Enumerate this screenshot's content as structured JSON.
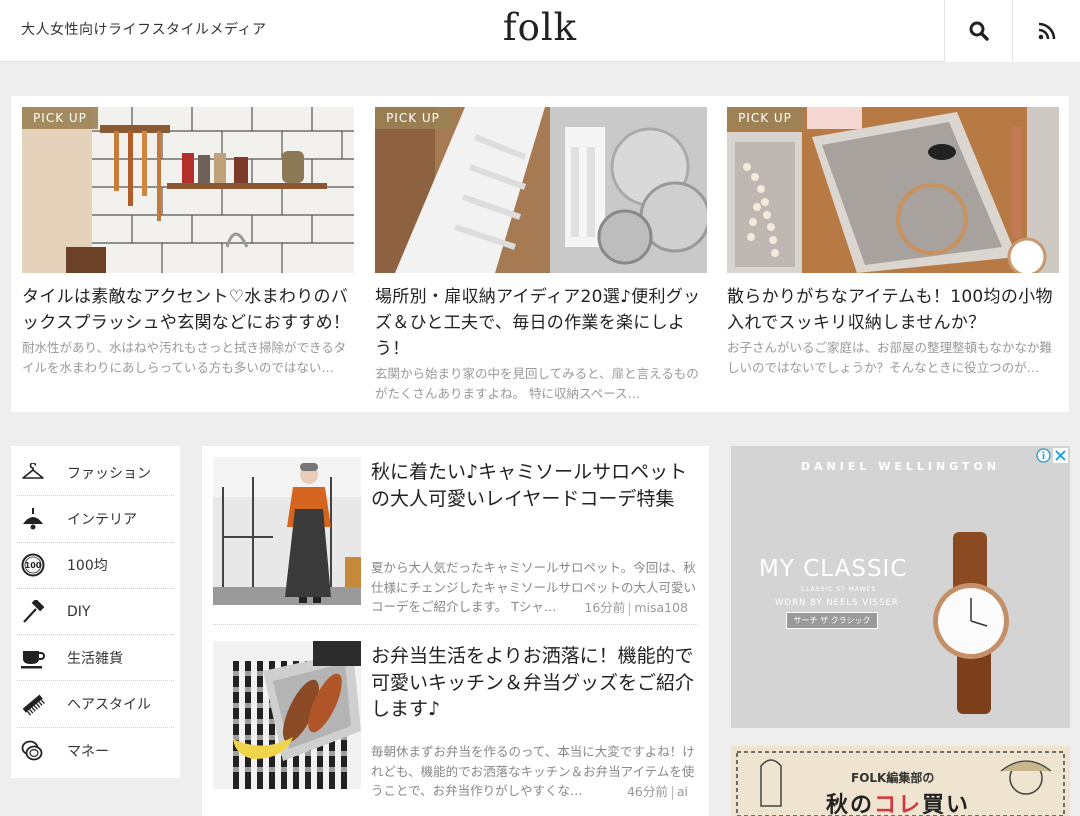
{
  "header": {
    "tagline": "大人女性向けライフスタイルメディア",
    "logo": "folk",
    "search_icon": "search-icon",
    "rss_icon": "rss-icon"
  },
  "pickup": {
    "badge": "PICK UP",
    "cards": [
      {
        "title": "タイルは素敵なアクセント♡水まわりのバックスプラッシュや玄関などにおすすめ！",
        "excerpt": "耐水性があり、水はねや汚れもさっと拭き掃除ができるタイルを水まわりにあしらっている方も多いのではない…"
      },
      {
        "title": "場所別・扉収納アイディア20選♪便利グッズ＆ひと工夫で、毎日の作業を楽にしよう！",
        "excerpt": "玄関から始まり家の中を見回してみると、扉と言えるものがたくさんありますよね。 特に収納スペース…"
      },
      {
        "title": "散らかりがちなアイテムも！100均の小物入れでスッキリ収納しませんか？",
        "excerpt": "お子さんがいるご家庭は、お部屋の整理整頓もなかなか難しいのではないでしょうか？そんなときに役立つのが…"
      }
    ]
  },
  "nav": {
    "items": [
      {
        "label": "ファッション",
        "icon": "hanger-icon"
      },
      {
        "label": "インテリア",
        "icon": "lamp-icon"
      },
      {
        "label": "100均",
        "icon": "coin-100-icon"
      },
      {
        "label": "DIY",
        "icon": "hammer-icon"
      },
      {
        "label": "生活雑貨",
        "icon": "cup-icon"
      },
      {
        "label": "ヘアスタイル",
        "icon": "comb-icon"
      },
      {
        "label": "マネー",
        "icon": "coins-icon"
      }
    ]
  },
  "articles": [
    {
      "title": "秋に着たい♪キャミソールサロペットの大人可愛いレイヤードコーデ特集",
      "excerpt": "夏から大人気だったキャミソールサロペット。今回は、秋仕様にチェンジしたキャミソールサロペットの大人可愛いコーデをご紹介します。 Tシャ…",
      "time": "16分前",
      "author": "misa108"
    },
    {
      "title": "お弁当生活をよりお洒落に！機能的で可愛いキッチン＆弁当グッズをご紹介します♪",
      "excerpt": "毎朝休まずお弁当を作るのって、本当に大変ですよね！けれども、機能的でお洒落なキッチン＆お弁当アイテムを使うことで、お弁当作りがしやすくな…",
      "time": "46分前",
      "author": "ai"
    }
  ],
  "ad": {
    "brand": "DANIEL WELLINGTON",
    "headline": "MY CLASSIC",
    "sub1": "CLASSIC ST MAWES",
    "sub2": "WORN BY NEELS VISSER",
    "cta": "サーチ ザ クラシック"
  },
  "ad2": {
    "line1": "FOLK編集部の",
    "line2a": "秋の",
    "line2b": "コレ",
    "line2c": "買い"
  },
  "colors": {
    "badge": "#9b8255",
    "background": "#eeeeee",
    "ad_accent": "#d8323a"
  }
}
